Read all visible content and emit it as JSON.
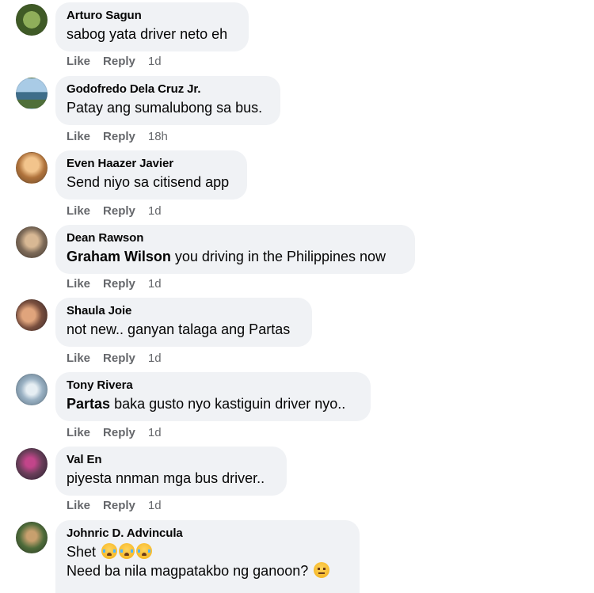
{
  "actions": {
    "like": "Like",
    "reply": "Reply"
  },
  "comments": [
    {
      "author": "Arturo Sagun",
      "text": "sabog yata driver neto eh",
      "time": "1d",
      "avatar_color": "#5d7a3a"
    },
    {
      "author": "Godofredo Dela Cruz Jr.",
      "text": "Patay ang sumalubong sa bus.",
      "time": "18h",
      "avatar_color": "#5f8fb0"
    },
    {
      "author": "Even Haazer Javier",
      "text": "Send niyo sa citisend app",
      "time": "1d",
      "avatar_color": "#c98d52"
    },
    {
      "author": "Dean Rawson",
      "mention": "Graham Wilson",
      "text": "you driving in the Philippines now",
      "time": "1d",
      "avatar_color": "#8a6a4f"
    },
    {
      "author": "Shaula Joie",
      "text": "not new.. ganyan talaga ang Partas",
      "time": "1d",
      "avatar_color": "#7a5a4a"
    },
    {
      "author": "Tony Rivera",
      "mention": "Partas",
      "text": "baka gusto nyo kastiguin driver nyo..",
      "time": "1d",
      "avatar_color": "#9bb2c4"
    },
    {
      "author": "Val En",
      "text": "piyesta nnman mga bus driver..",
      "time": "1d",
      "avatar_color": "#6b3e5a"
    },
    {
      "author": "Johnric D. Advincula",
      "text": "Shet",
      "emoji": [
        "crying-face-emoji",
        "crying-face-emoji",
        "crying-face-emoji"
      ],
      "text2": "Need ba nila magpatakbo ng ganoon?",
      "emoji2": "expressionless-face-emoji",
      "avatar_color": "#4e6b3a"
    }
  ]
}
